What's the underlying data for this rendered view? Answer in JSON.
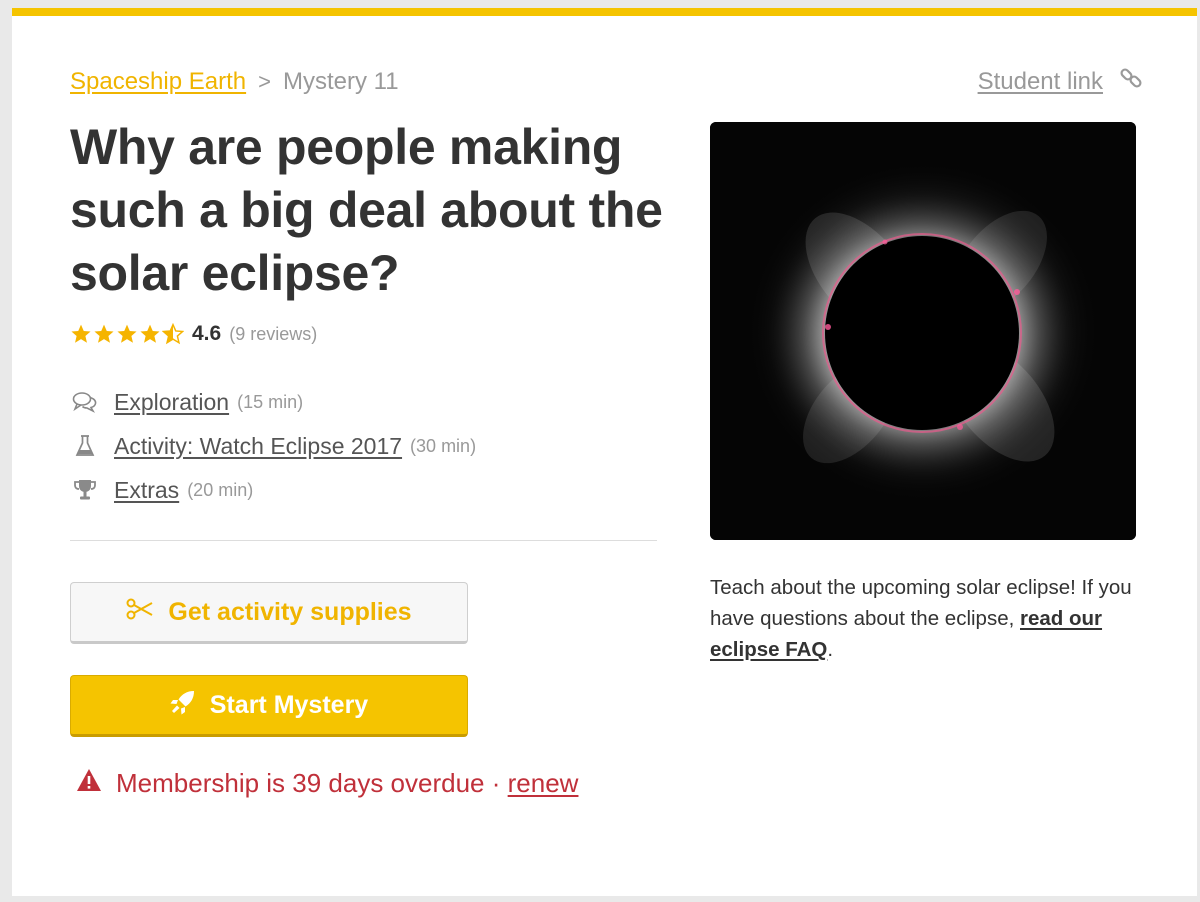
{
  "breadcrumb": {
    "parent": "Spaceship Earth",
    "separator": ">",
    "current": "Mystery 11"
  },
  "student_link": {
    "label": "Student link",
    "icon": "link-icon"
  },
  "title": "Why are people making such a big deal about the solar eclipse?",
  "rating": {
    "stars": 4.5,
    "max_stars": 5,
    "value": "4.6",
    "count": "(9 reviews)"
  },
  "parts": [
    {
      "icon": "speech-bubbles-icon",
      "label": "Exploration",
      "duration": "(15 min)"
    },
    {
      "icon": "flask-icon",
      "label": "Activity: Watch Eclipse 2017",
      "duration": "(30 min)"
    },
    {
      "icon": "trophy-icon",
      "label": "Extras",
      "duration": "(20 min)"
    }
  ],
  "buttons": {
    "supplies": {
      "label": "Get activity supplies",
      "icon": "scissors-icon"
    },
    "start": {
      "label": "Start Mystery",
      "icon": "rocket-icon"
    }
  },
  "warning": {
    "text": "Membership is 39 days overdue ·",
    "link": "renew",
    "icon": "warning-triangle-icon"
  },
  "description": {
    "text": "Teach about the upcoming solar eclipse! If you have questions about the eclipse,",
    "link": "read our eclipse FAQ",
    "end": "."
  },
  "colors": {
    "accent": "#f5c400",
    "link_yellow": "#f0b400",
    "warning": "#c0303a",
    "text": "#333333",
    "muted": "#999999"
  }
}
